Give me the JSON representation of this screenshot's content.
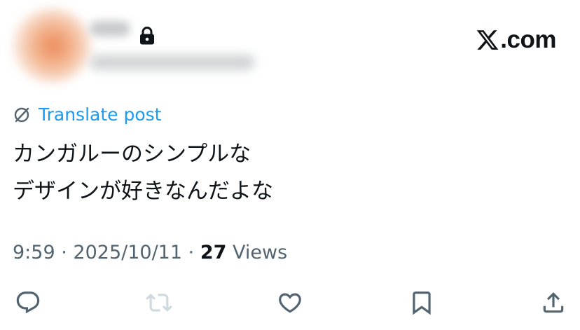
{
  "header": {
    "brand": "X.com",
    "brand_suffix": ".com",
    "lock_icon": "lock-icon"
  },
  "translate": {
    "label": "Translate post",
    "icon": "globe-translate-icon"
  },
  "post": {
    "lines": [
      "カンガルーのシンプルな",
      "デザインが好きなんだよな"
    ]
  },
  "meta": {
    "time": "9:59",
    "separator": "·",
    "date": "2025/10/11",
    "views_count": "27",
    "views_label": "Views"
  },
  "actions": [
    "reply-icon",
    "repost-icon",
    "like-icon",
    "bookmark-icon",
    "share-icon"
  ],
  "colors": {
    "text": "#0f1419",
    "secondary": "#536471",
    "link": "#1d9bf0",
    "disabled": "#cfd9de"
  }
}
